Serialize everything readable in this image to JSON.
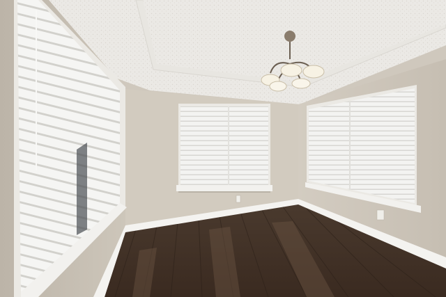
{
  "scene": {
    "subject": "empty-room",
    "colors": {
      "ceiling": "#ebe9e5",
      "wall_back": "#d2cbbf",
      "wall_right": "#cdc5b9",
      "wall_left": "#c9c1b4",
      "floor_dark": "#3b2c22",
      "floor_mid": "#5a4636",
      "baseboard": "#f4f3f0",
      "blinds": "#f1f1ef",
      "window_trim": "#ebe9e4",
      "chandelier_metal": "#6b5f52",
      "chandelier_glass": "#f7f2e4"
    }
  }
}
